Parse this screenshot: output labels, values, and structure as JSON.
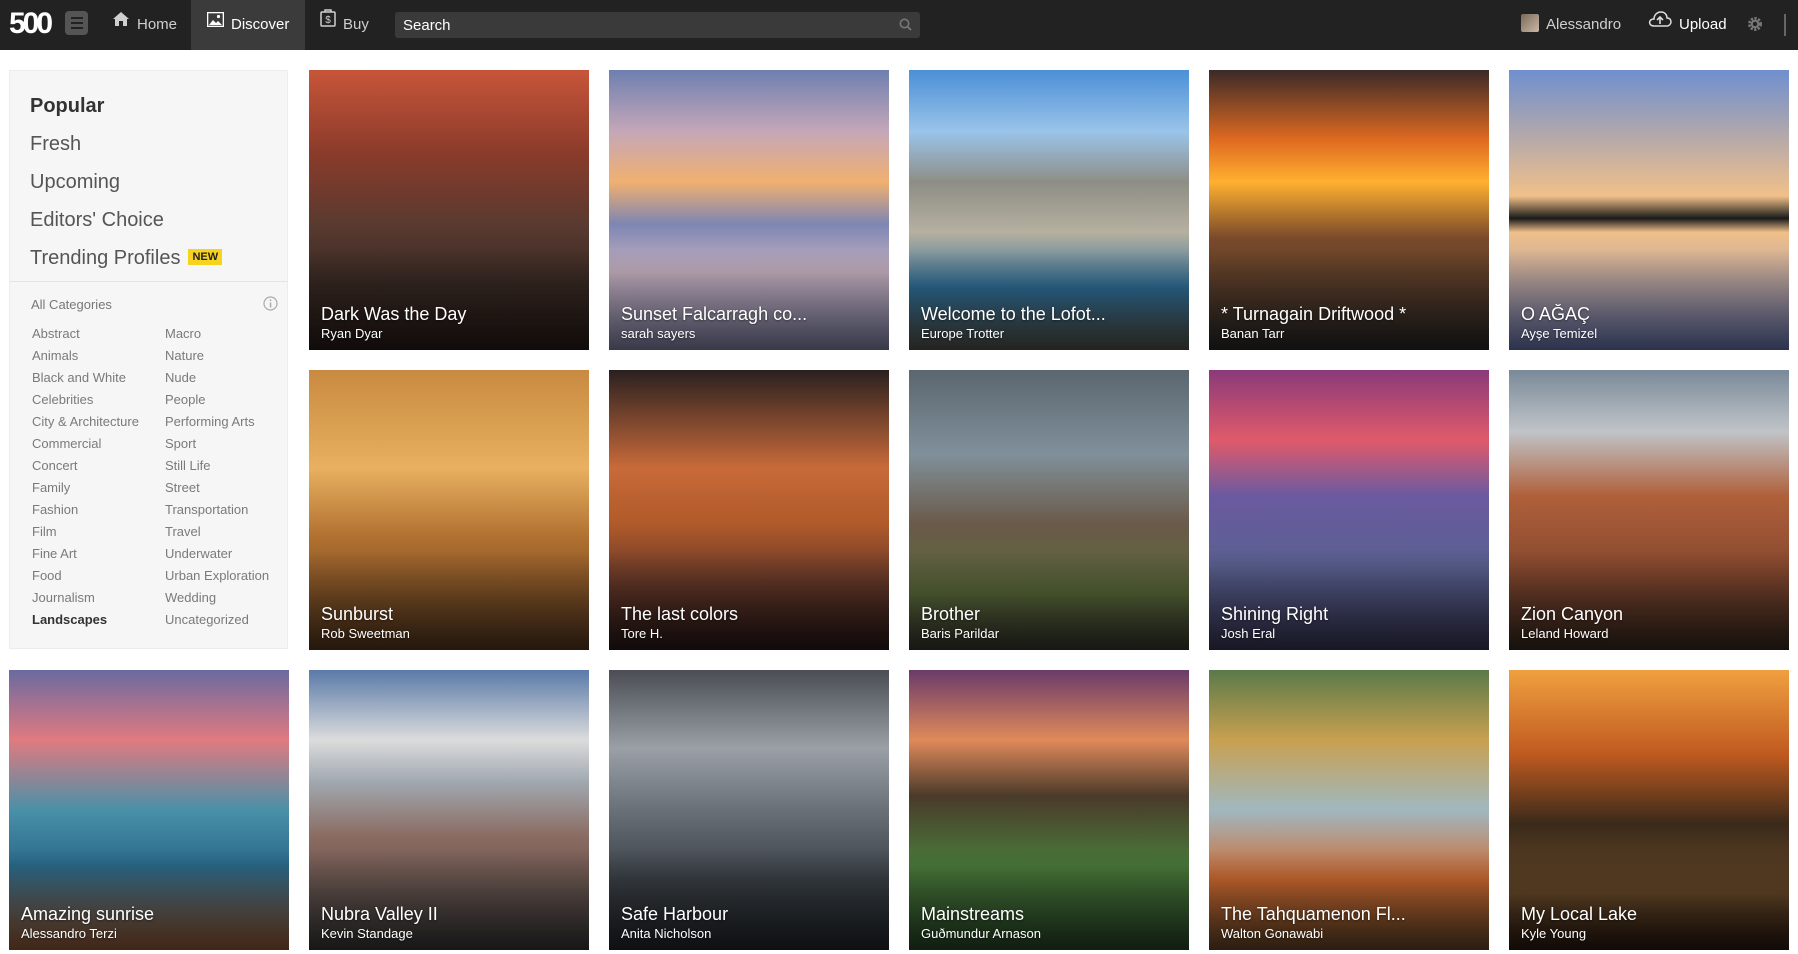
{
  "nav": {
    "logo": "500",
    "home": "Home",
    "discover": "Discover",
    "buy": "Buy",
    "search_placeholder": "Search",
    "user_name": "Alessandro",
    "upload": "Upload"
  },
  "sidebar": {
    "features": [
      {
        "label": "Popular",
        "active": true
      },
      {
        "label": "Fresh"
      },
      {
        "label": "Upcoming"
      },
      {
        "label": "Editors' Choice"
      },
      {
        "label": "Trending Profiles"
      }
    ],
    "new_badge": "NEW",
    "all_categories": "All Categories",
    "categories_left": [
      "Abstract",
      "Animals",
      "Black and White",
      "Celebrities",
      "City & Architecture",
      "Commercial",
      "Concert",
      "Family",
      "Fashion",
      "Film",
      "Fine Art",
      "Food",
      "Journalism",
      "Landscapes"
    ],
    "categories_right": [
      "Macro",
      "Nature",
      "Nude",
      "People",
      "Performing Arts",
      "Sport",
      "Still Life",
      "Street",
      "Transportation",
      "Travel",
      "Underwater",
      "Urban Exploration",
      "Wedding",
      "Uncategorized"
    ],
    "active_category": "Landscapes"
  },
  "photos": [
    {
      "title": "Dark Was the Day",
      "author": "Ryan Dyar"
    },
    {
      "title": "Sunset Falcarragh co...",
      "author": "sarah sayers"
    },
    {
      "title": "Welcome to the Lofot...",
      "author": "Europe Trotter"
    },
    {
      "title": "* Turnagain Driftwood *",
      "author": "Banan Tarr"
    },
    {
      "title": "O AĞAÇ",
      "author": "Ayşe Temizel"
    },
    {
      "title": "Sunburst",
      "author": "Rob Sweetman"
    },
    {
      "title": "The last colors",
      "author": "Tore H."
    },
    {
      "title": "Brother",
      "author": "Baris Parildar"
    },
    {
      "title": "Shining Right",
      "author": "Josh Eral"
    },
    {
      "title": "Zion Canyon",
      "author": "Leland Howard"
    },
    {
      "title": "Amazing sunrise",
      "author": "Alessandro Terzi"
    },
    {
      "title": "Nubra Valley II",
      "author": "Kevin Standage"
    },
    {
      "title": "Safe Harbour",
      "author": "Anita Nicholson"
    },
    {
      "title": "Mainstreams",
      "author": "Guðmundur Arnason"
    },
    {
      "title": "The Tahquamenon Fl...",
      "author": "Walton Gonawabi"
    },
    {
      "title": "My Local Lake",
      "author": "Kyle Young"
    }
  ],
  "colors": {
    "topbar": "#222222",
    "badge": "#f7d320",
    "sidebar_bg": "#f6f6f6"
  }
}
